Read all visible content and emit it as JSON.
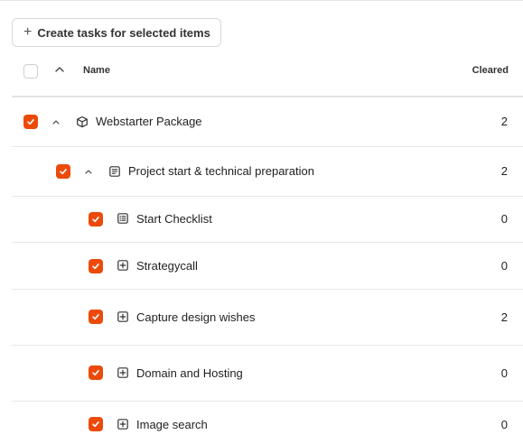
{
  "toolbar": {
    "create_label": "Create tasks for selected items",
    "plus_icon": "+"
  },
  "table": {
    "headers": {
      "name": "Name",
      "cleared": "Cleared"
    },
    "rows": [
      {
        "label": "Webstarter Package",
        "cleared": "2",
        "icon": "package-icon",
        "checked": true,
        "expanded": true
      },
      {
        "label": "Project start & technical preparation",
        "cleared": "2",
        "icon": "document-icon",
        "checked": true,
        "expanded": true
      },
      {
        "label": "Start Checklist",
        "cleared": "0",
        "icon": "checklist-icon",
        "checked": true
      },
      {
        "label": "Strategycall",
        "cleared": "0",
        "icon": "plus-square-icon",
        "checked": true
      },
      {
        "label": "Capture design wishes",
        "cleared": "2",
        "icon": "plus-square-icon",
        "checked": true
      },
      {
        "label": "Domain and Hosting",
        "cleared": "0",
        "icon": "plus-square-icon",
        "checked": true
      },
      {
        "label": "Image search",
        "cleared": "0",
        "icon": "plus-square-icon",
        "checked": true
      }
    ]
  },
  "colors": {
    "accent": "#ec4a0a",
    "border": "#e8e8e8",
    "text": "#1f1f1f"
  }
}
